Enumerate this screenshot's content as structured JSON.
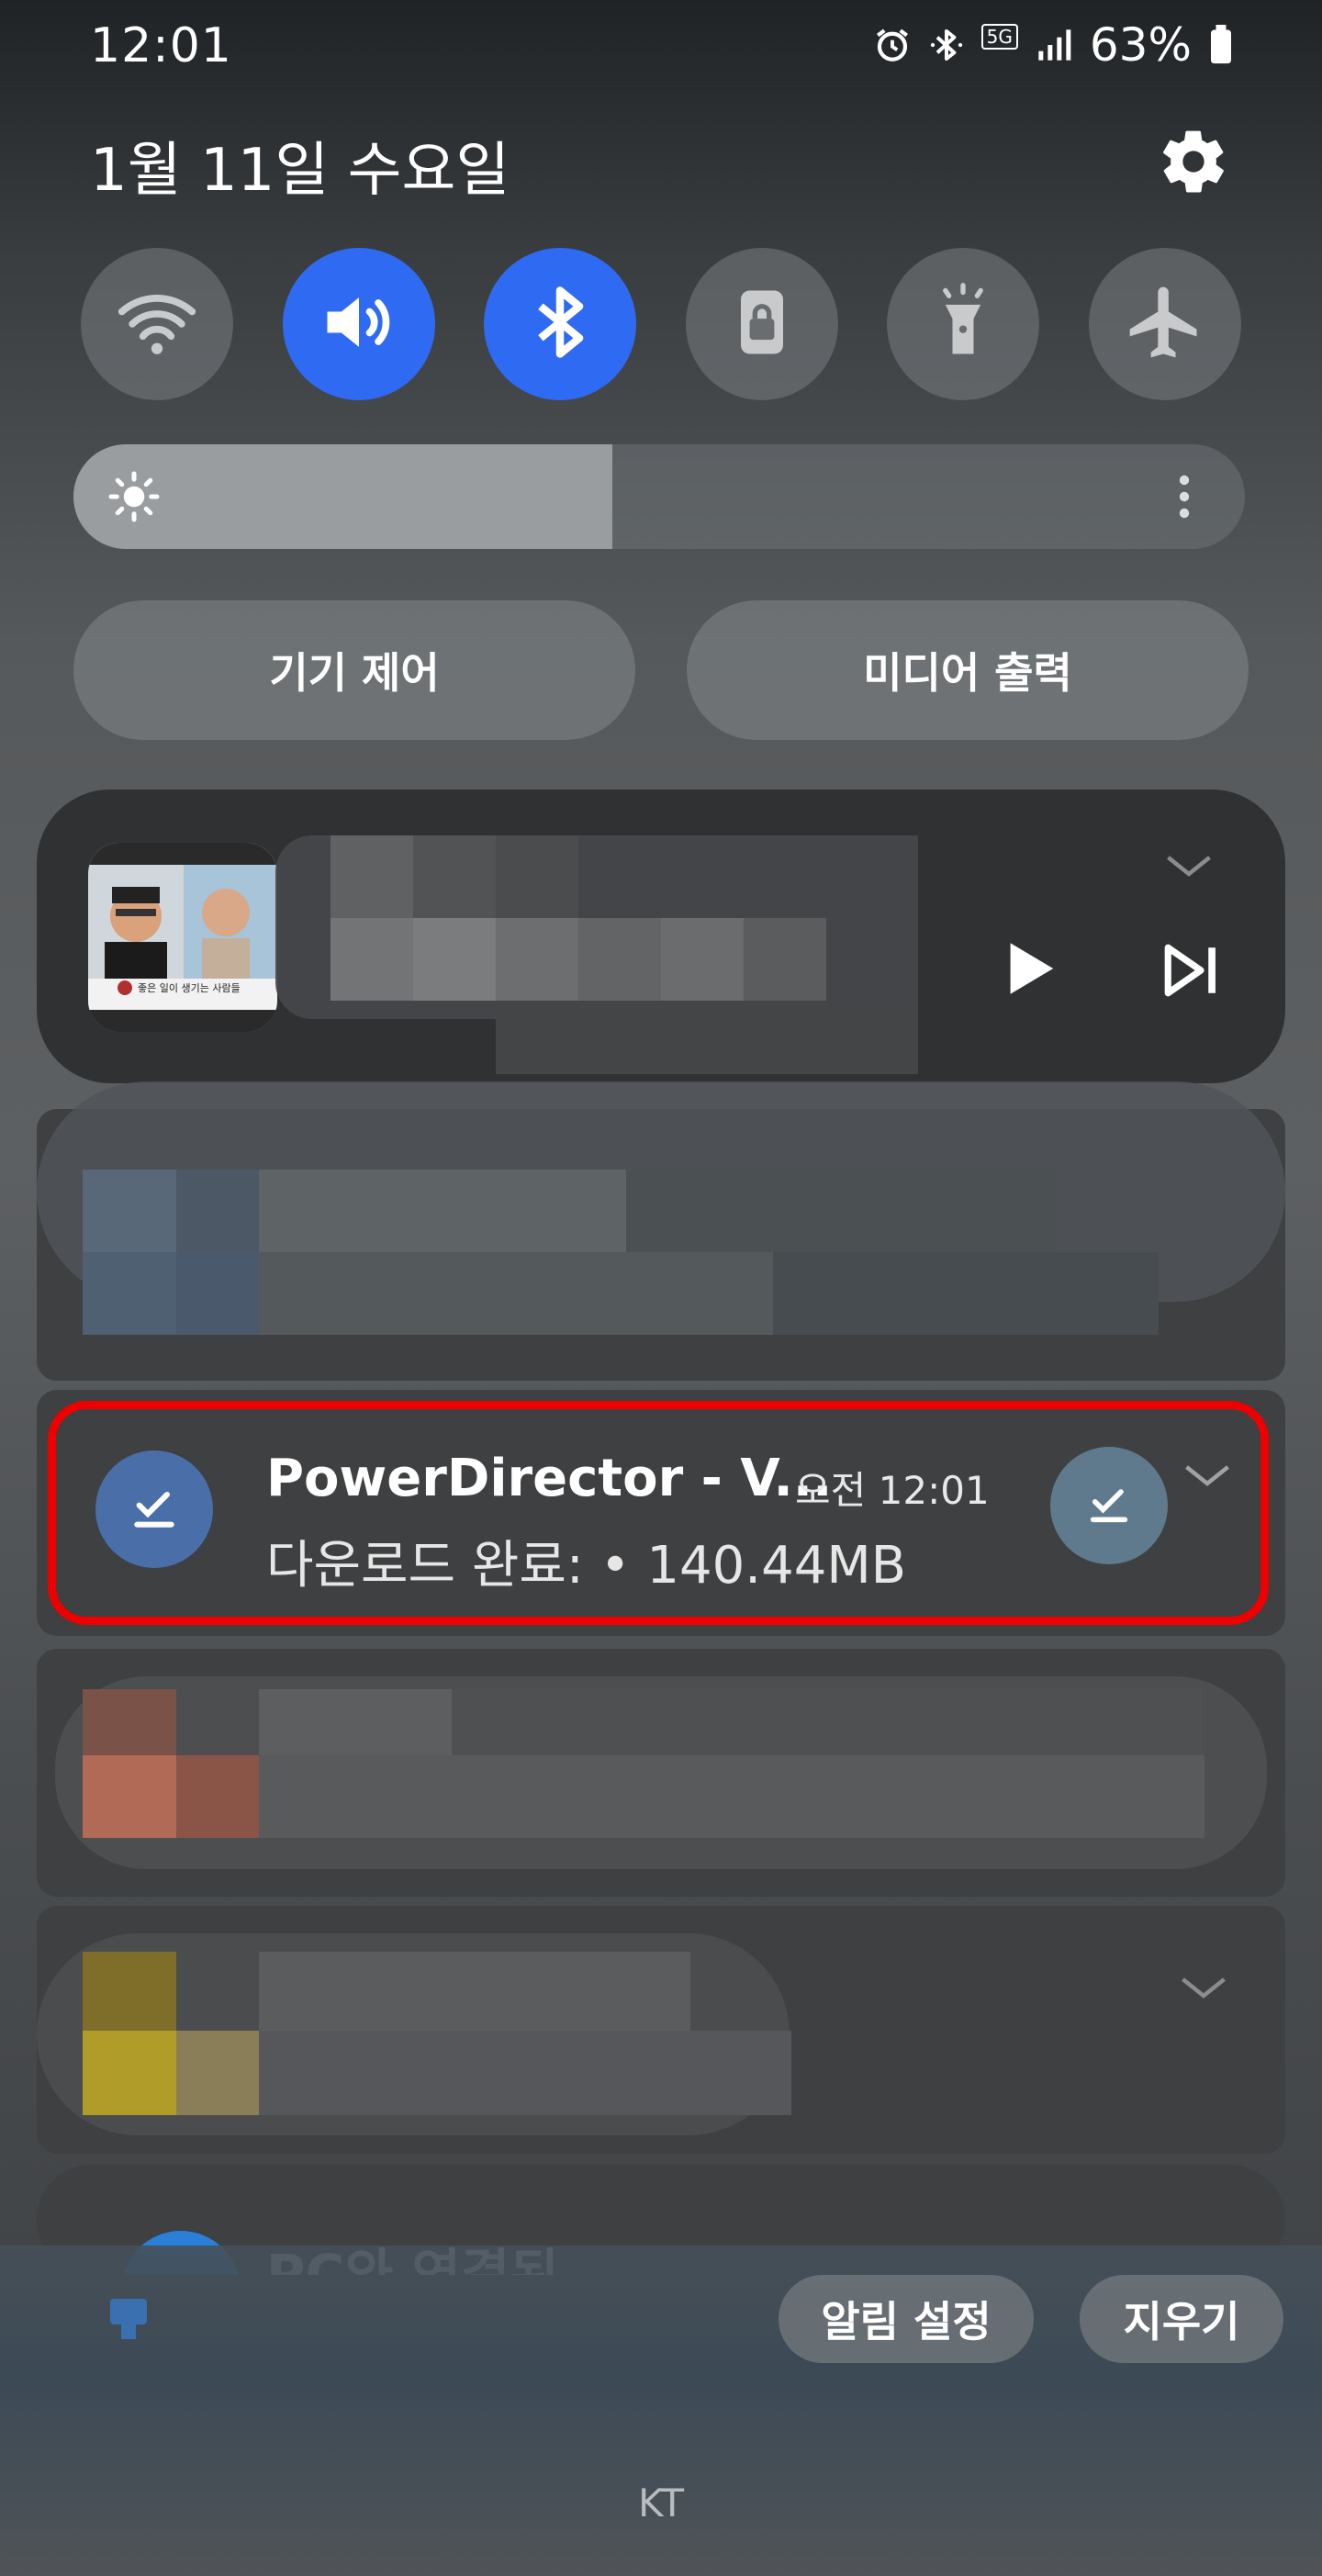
{
  "status_bar": {
    "time": "12:01",
    "network": "5G",
    "battery": "63%",
    "icons": [
      "alarm-icon",
      "bluetooth-icon",
      "5g-icon",
      "signal-icon",
      "battery-icon"
    ]
  },
  "header": {
    "date": "1월 11일 수요일",
    "settings_icon": "gear-icon"
  },
  "quick_toggles": [
    {
      "name": "wifi",
      "icon": "wifi-icon",
      "active": false
    },
    {
      "name": "sound",
      "icon": "volume-icon",
      "active": true
    },
    {
      "name": "bluetooth",
      "icon": "bluetooth-icon",
      "active": true
    },
    {
      "name": "screen-lock",
      "icon": "lock-icon",
      "active": false
    },
    {
      "name": "flashlight",
      "icon": "flashlight-icon",
      "active": false
    },
    {
      "name": "airplane",
      "icon": "airplane-icon",
      "active": false
    }
  ],
  "brightness": {
    "level_percent": 46
  },
  "buttons": {
    "device_control": "기기 제어",
    "media_output": "미디어 출력"
  },
  "media_player": {
    "thumb_caption": "좋은 일이 생기는 사람들",
    "controls": [
      "play-icon",
      "skip-next-icon",
      "chevron-down-icon"
    ]
  },
  "notification_pd": {
    "title": "PowerDirector - V...",
    "time": "오전 12:01",
    "subtitle": "다운로드 완료: • 140.44MB"
  },
  "peek_notification": {
    "title": "PC와 연결된"
  },
  "footer": {
    "notification_settings": "알림 설정",
    "clear_all": "지우기",
    "carrier": "KT"
  },
  "colors": {
    "accent_blue": "#2f6af2",
    "highlight_red": "#ee0000",
    "card_bg": "#3e4042"
  }
}
